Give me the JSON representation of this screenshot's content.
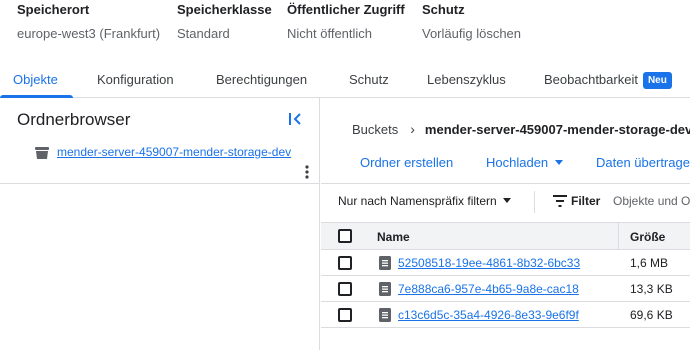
{
  "meta": [
    {
      "label": "Speicherort",
      "value": "europe-west3 (Frankfurt)"
    },
    {
      "label": "Speicherklasse",
      "value": "Standard"
    },
    {
      "label": "Öffentlicher Zugriff",
      "value": "Nicht öffentlich"
    },
    {
      "label": "Schutz",
      "value": "Vorläufig löschen"
    }
  ],
  "tabs": [
    {
      "label": "Objekte",
      "active": true
    },
    {
      "label": "Konfiguration"
    },
    {
      "label": "Berechtigungen"
    },
    {
      "label": "Schutz"
    },
    {
      "label": "Lebenszyklus"
    },
    {
      "label": "Beobachtbarkeit",
      "badge": "Neu"
    }
  ],
  "folder_browser": {
    "title": "Ordnerbrowser",
    "bucket": "mender-server-459007-mender-storage-dev"
  },
  "breadcrumb": {
    "root": "Buckets",
    "current": "mender-server-459007-mender-storage-dev"
  },
  "actions": {
    "create_folder": "Ordner erstellen",
    "upload": "Hochladen",
    "transfer": "Daten übertragen"
  },
  "filter": {
    "prefix_label": "Nur nach Namenspräfix filtern",
    "filter_label": "Filter",
    "placeholder": "Objekte und Ordner filtern"
  },
  "table": {
    "columns": {
      "name": "Name",
      "size": "Größe"
    },
    "rows": [
      {
        "name": "52508518-19ee-4861-8b32-6bc33",
        "size": "1,6 MB"
      },
      {
        "name": "7e888ca6-957e-4b65-9a8e-cac18",
        "size": "13,3 KB"
      },
      {
        "name": "c13c6d5c-35a4-4926-8e33-9e6f9f",
        "size": "69,6 KB"
      }
    ]
  },
  "colors": {
    "accent": "#1a73e8",
    "border": "#dadce0",
    "header_bg": "#f1f3f4"
  }
}
